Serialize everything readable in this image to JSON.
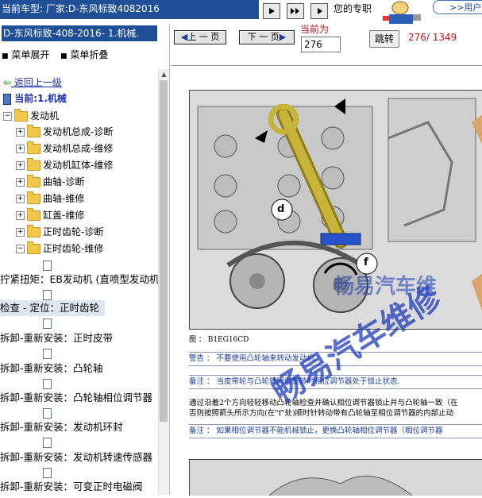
{
  "topbar": {
    "car_label": "当前车型:   厂家:D-东风标致4082016",
    "nav_icons": [
      "play-icon",
      "double-play-icon",
      "play-left-icon"
    ],
    "expert_text": "您的专职",
    "more_link": ">>用户"
  },
  "left": {
    "selected_title": "D-东风标致-408-2016- 1.机械.",
    "expand_all": "菜单展开",
    "collapse_all": "菜单折叠",
    "back": "返回上一级",
    "current": "当前:1.机械",
    "root": "发动机",
    "children": [
      "发动机总成-诊断",
      "发动机总成-维修",
      "发动机缸体-维修",
      "曲轴-诊断",
      "曲轴-维修",
      "缸盖-维修",
      "正时齿轮-诊断",
      "正时齿轮-维修"
    ],
    "leaves": [
      "拧紧扭矩：EB发动机 (直喷型发动机",
      "检查 - 定位：正时齿轮",
      "拆卸-重新安装：正时皮带",
      "拆卸-重新安装：凸轮轴",
      "拆卸-重新安装：凸轮轴相位调节器",
      "拆卸-重新安装：发动机环封",
      "拆卸-重新安装：发动机转速传感器",
      "拆卸-重新安装：可变正时电磁阀"
    ]
  },
  "pager": {
    "prev": "上 一 页",
    "next": "下 一 页",
    "current_label": "当前为",
    "current_value": "276",
    "jump": "跳转",
    "count": "276/ 1349"
  },
  "doc": {
    "callout_d": "d",
    "callout_f": "f",
    "figure_caption": "图 ： B1EG16CD",
    "warning": "警告 ：  不要使用凸轮轴来转动发动机.",
    "note1": "备注 ：  当皮带轮与凸轮轴同时旋转时相位调节器处于锁止状态.",
    "body1": "通过沿着2个方向轻轻移动凸轮轴检查并确认相位调节器锁止并与凸轮轴一致（在",
    "body2": "否则按照箭头所示方向(在\"f\"处)顺时针转动带有凸轮轴至相位调节器的内部止动",
    "note2": "备注 ：  如果相位调节器不能机械锁止，更换凸轮轴相位调节器（相位调节器",
    "watermark_small": "畅易汽车维",
    "watermark_large": "畅易汽车维修"
  },
  "colors": {
    "title_bg": "#1f4f96",
    "count_red": "#c0141c",
    "link_blue": "#1a3aa0"
  }
}
